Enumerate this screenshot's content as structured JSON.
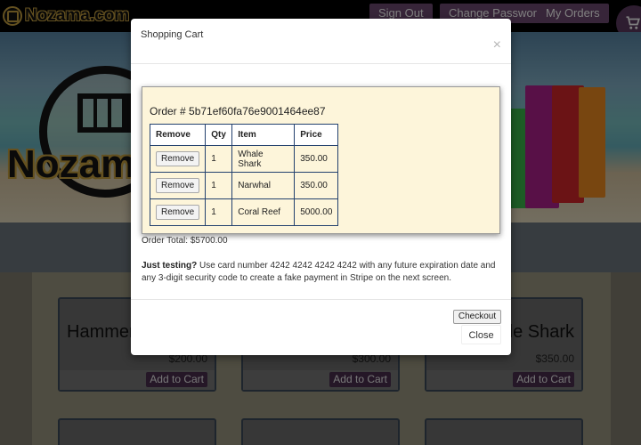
{
  "brand": {
    "name": "Nozama.com",
    "hero_word": "Nozama"
  },
  "nav": {
    "sign_out": "Sign Out",
    "change_password": "Change Password",
    "my_orders": "My Orders"
  },
  "products": [
    {
      "name": "Hammerhead Shark",
      "price": "$200.00",
      "add_label": "Add to Cart"
    },
    {
      "name": "",
      "price": "$300.00",
      "add_label": "Add to Cart"
    },
    {
      "name": "Whale Shark",
      "price": "$350.00",
      "add_label": "Add to Cart"
    }
  ],
  "modal": {
    "title": "Shopping Cart",
    "close_symbol": "×",
    "order_id": "Order # 5b71ef60fa76e9001464ee87",
    "columns": [
      "Remove",
      "Qty",
      "Item",
      "Price"
    ],
    "items": [
      {
        "remove_label": "Remove",
        "qty": "1",
        "item": "Whale Shark",
        "price": "350.00"
      },
      {
        "remove_label": "Remove",
        "qty": "1",
        "item": "Narwhal",
        "price": "350.00"
      },
      {
        "remove_label": "Remove",
        "qty": "1",
        "item": "Coral Reef",
        "price": "5000.00"
      }
    ],
    "order_total": "Order Total: $5700.00",
    "testing_lead": "Just testing?",
    "testing_text": " Use card number 4242 4242 4242 4242 with any future expiration date and any 3-digit security code to create a fake payment in Stripe on the next screen.",
    "checkout_label": "Checkout",
    "close_label": "Close"
  },
  "colors": {
    "nav_button": "#6e4a73",
    "order_box": "#fdf5da",
    "table_border": "#23416e",
    "overlay": "rgba(0,0,0,0.5)"
  },
  "icons": [
    "globe-logo-icon",
    "cart-icon",
    "close-icon"
  ]
}
